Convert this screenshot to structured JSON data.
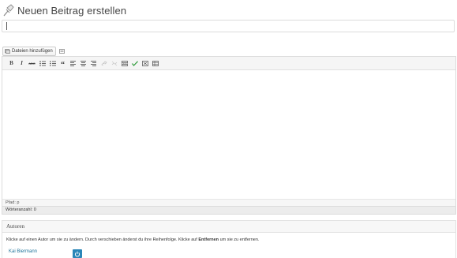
{
  "page": {
    "title": "Neuen Beitrag erstellen",
    "title_input_value": ""
  },
  "media": {
    "add_files_label": "Dateien hinzufügen"
  },
  "toolbar": {
    "buttons": [
      {
        "name": "bold",
        "glyph": "B"
      },
      {
        "name": "italic",
        "glyph": "I"
      },
      {
        "name": "strikethrough",
        "glyph": "ABC"
      },
      {
        "name": "bullet-list",
        "glyph": ""
      },
      {
        "name": "numbered-list",
        "glyph": ""
      },
      {
        "name": "blockquote",
        "glyph": "“"
      },
      {
        "name": "align-left",
        "glyph": ""
      },
      {
        "name": "align-center",
        "glyph": ""
      },
      {
        "name": "align-right",
        "glyph": ""
      },
      {
        "name": "link",
        "glyph": ""
      },
      {
        "name": "unlink",
        "glyph": ""
      },
      {
        "name": "more",
        "glyph": ""
      },
      {
        "name": "spellcheck",
        "glyph": ""
      },
      {
        "name": "fullscreen",
        "glyph": ""
      },
      {
        "name": "kitchen-sink",
        "glyph": ""
      }
    ]
  },
  "editor": {
    "path_label": "Pfad: p",
    "word_count_label": "Wörteranzahl: 0"
  },
  "authors": {
    "heading": "Autoren",
    "hint_before": "Klicke auf einen Autor um sie zu ändern. Durch verschieben änderst du ihre Reihenfolge. Klicke auf ",
    "hint_bold": "Entfernen",
    "hint_after": " um sie zu entfernen.",
    "items": [
      {
        "name": "Kai Biermann"
      }
    ]
  },
  "colors": {
    "link": "#21759b",
    "remove_button": "#2a86b8",
    "spellcheck": "#2e9b3a"
  }
}
